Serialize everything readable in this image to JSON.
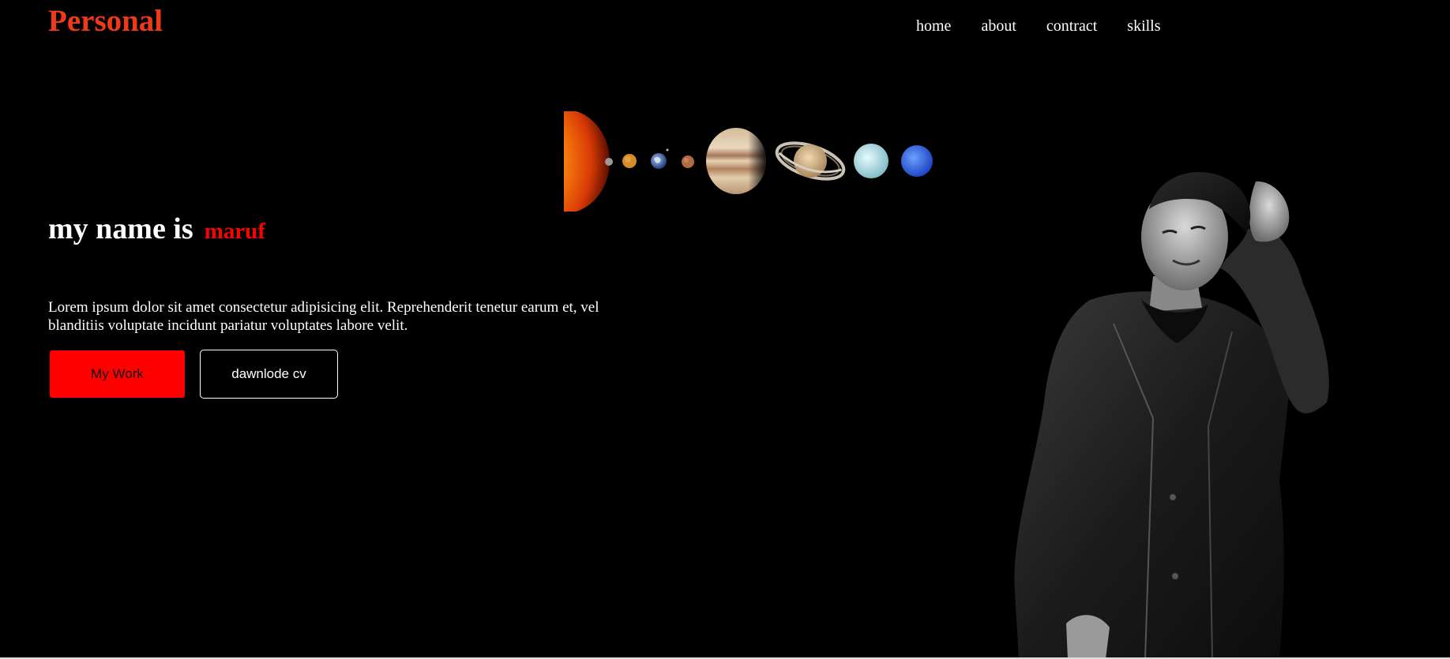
{
  "header": {
    "logo": "Personal",
    "nav": [
      {
        "label": "home"
      },
      {
        "label": "about"
      },
      {
        "label": "contract"
      },
      {
        "label": "skills"
      }
    ]
  },
  "hero": {
    "title_prefix": "my name is",
    "title_name": "maruf",
    "description": "Lorem ipsum dolor sit amet consectetur adipisicing elit. Reprehenderit tenetur earum et, vel blanditiis voluptate incidunt pariatur voluptates labore velit.",
    "buttons": {
      "work_label": "My Work",
      "cv_label": "dawnlode cv"
    }
  },
  "colors": {
    "background": "#000000",
    "logo": "#f03a17",
    "accent": "#ff0000",
    "text": "#ffffff"
  },
  "images": {
    "solar_system": "solar-system-planets-image",
    "portrait": "person-portrait-grayscale-image"
  }
}
